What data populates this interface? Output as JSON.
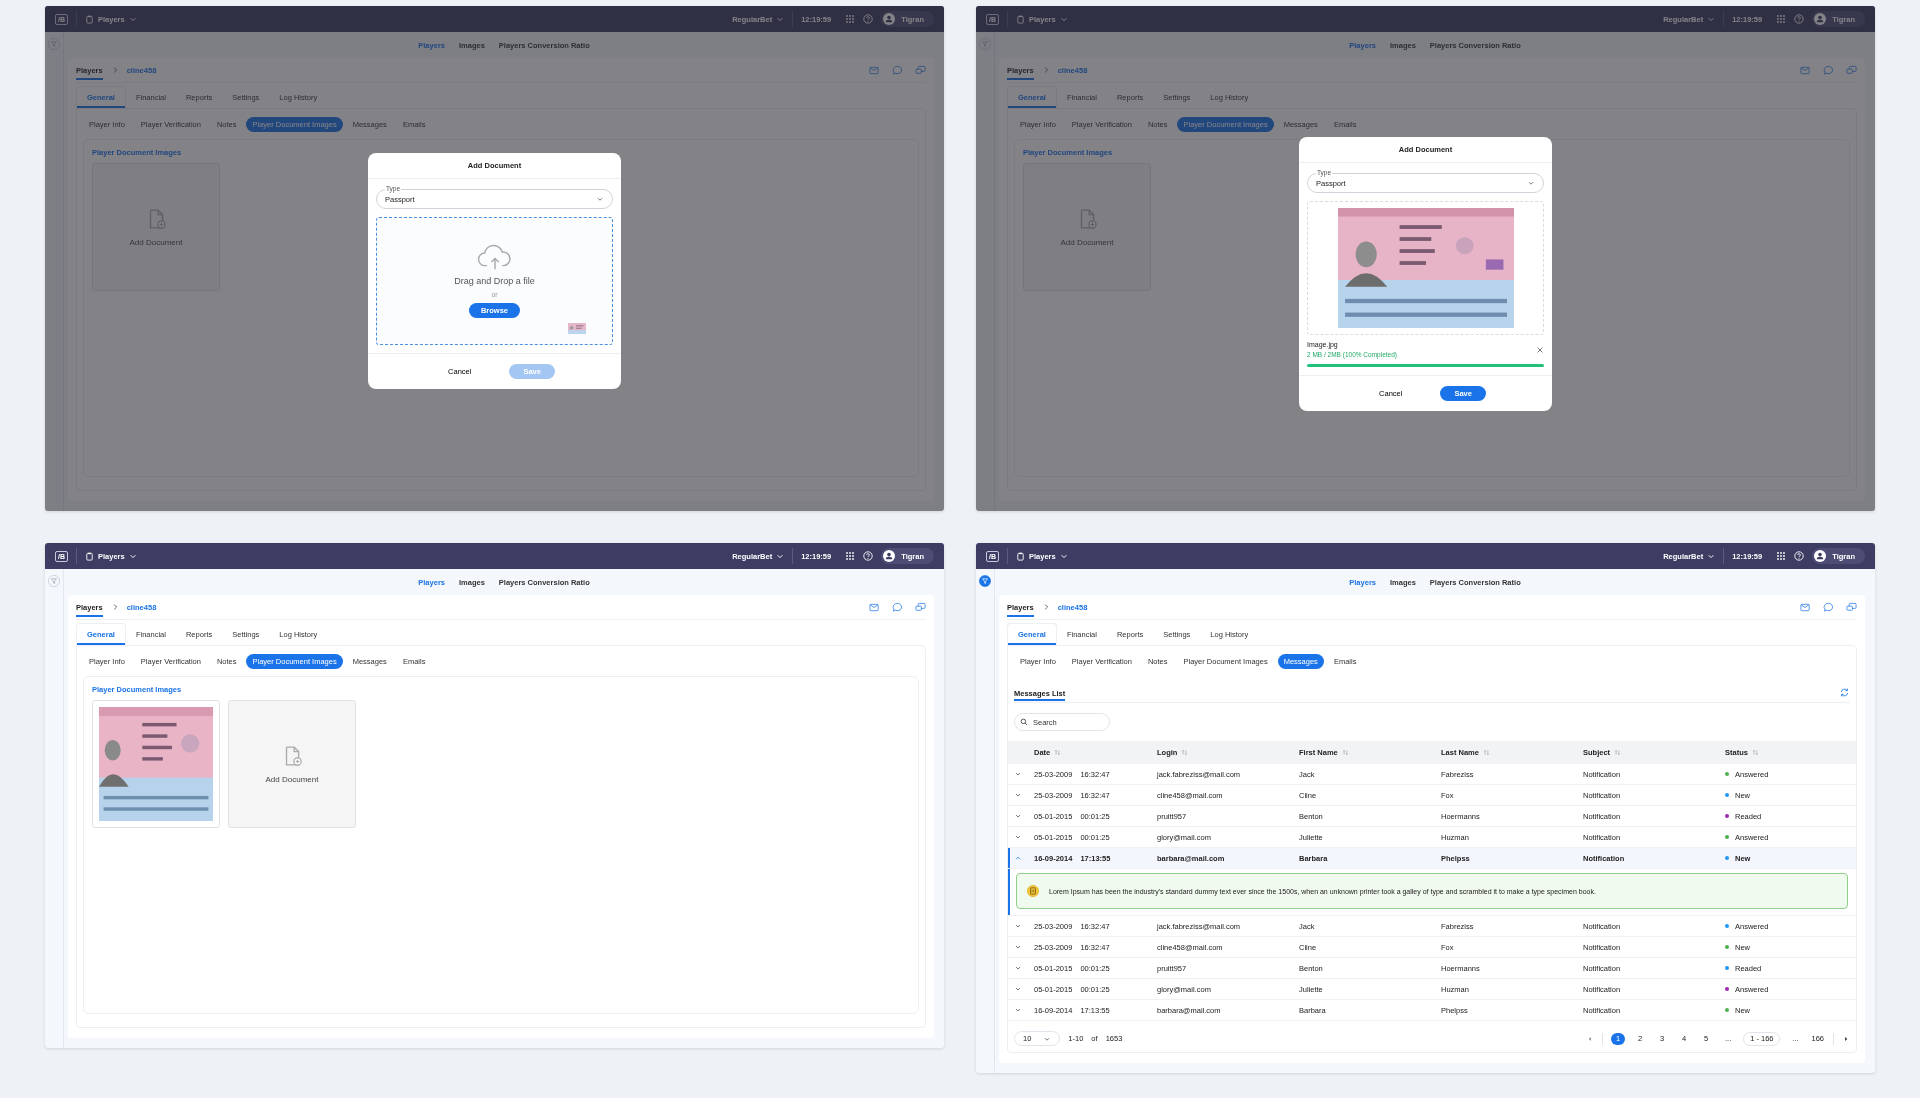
{
  "screens": [
    {
      "topbar": {
        "logo": "/B",
        "module": "Players",
        "brand": "RegularBet",
        "time": "12:19:59",
        "user": "Tigran"
      },
      "filter_active": false,
      "nav": [
        {
          "label": "Players",
          "selected": true
        },
        {
          "label": "Images",
          "selected": false
        },
        {
          "label": "Players Conversion Ratio",
          "selected": false
        }
      ],
      "breadcrumb": [
        "Players",
        "cline458"
      ],
      "tabs": [
        {
          "label": "General",
          "selected": true
        },
        {
          "label": "Financial",
          "selected": false
        },
        {
          "label": "Reports",
          "selected": false
        },
        {
          "label": "Settings",
          "selected": false
        },
        {
          "label": "Log History",
          "selected": false
        }
      ],
      "subtabs": [
        {
          "label": "Player Info",
          "selected": false
        },
        {
          "label": "Player Verification",
          "selected": false
        },
        {
          "label": "Notes",
          "selected": false
        },
        {
          "label": "Player Document Images",
          "selected": true
        },
        {
          "label": "Messages",
          "selected": false
        },
        {
          "label": "Emails",
          "selected": false
        }
      ],
      "content": {
        "kind": "documents",
        "title": "Player Document Images",
        "items": [
          {
            "kind": "add",
            "label": "Add Document"
          }
        ]
      },
      "modal": {
        "title": "Add Document",
        "field": {
          "label": "Type",
          "value": "Passport"
        },
        "body": {
          "kind": "dropzone",
          "text": "Drag and Drop a file",
          "or": "or",
          "button": "Browse"
        },
        "buttons": [
          {
            "label": "Cancel",
            "kind": "text",
            "disabled": false
          },
          {
            "label": "Save",
            "kind": "primary",
            "disabled": true
          }
        ]
      }
    },
    {
      "topbar": {
        "logo": "/B",
        "module": "Players",
        "brand": "RegularBet",
        "time": "12:19:59",
        "user": "Tigran"
      },
      "filter_active": false,
      "nav": [
        {
          "label": "Players",
          "selected": true
        },
        {
          "label": "Images",
          "selected": false
        },
        {
          "label": "Players Conversion Ratio",
          "selected": false
        }
      ],
      "breadcrumb": [
        "Players",
        "cline458"
      ],
      "tabs": [
        {
          "label": "General",
          "selected": true
        },
        {
          "label": "Financial",
          "selected": false
        },
        {
          "label": "Reports",
          "selected": false
        },
        {
          "label": "Settings",
          "selected": false
        },
        {
          "label": "Log History",
          "selected": false
        }
      ],
      "subtabs": [
        {
          "label": "Player Info",
          "selected": false
        },
        {
          "label": "Player Verification",
          "selected": false
        },
        {
          "label": "Notes",
          "selected": false
        },
        {
          "label": "Player Document Images",
          "selected": true
        },
        {
          "label": "Messages",
          "selected": false
        },
        {
          "label": "Emails",
          "selected": false
        }
      ],
      "content": {
        "kind": "documents",
        "title": "Player Document Images",
        "items": [
          {
            "kind": "add",
            "label": "Add Document"
          }
        ]
      },
      "modal": {
        "title": "Add Document",
        "field": {
          "label": "Type",
          "value": "Passport"
        },
        "body": {
          "kind": "preview",
          "file": "Image.jpg",
          "progress_text": "2 MB / 2MB (100% Completed)",
          "level": 1
        },
        "buttons": [
          {
            "label": "Cancel",
            "kind": "text",
            "disabled": false
          },
          {
            "label": "Save",
            "kind": "primary",
            "disabled": false
          }
        ]
      }
    },
    {
      "topbar": {
        "logo": "/B",
        "module": "Players",
        "brand": "RegularBet",
        "time": "12:19:59",
        "user": "Tigran"
      },
      "filter_active": false,
      "nav": [
        {
          "label": "Players",
          "selected": true
        },
        {
          "label": "Images",
          "selected": false
        },
        {
          "label": "Players Conversion Ratio",
          "selected": false
        }
      ],
      "breadcrumb": [
        "Players",
        "cline458"
      ],
      "tabs": [
        {
          "label": "General",
          "selected": true
        },
        {
          "label": "Financial",
          "selected": false
        },
        {
          "label": "Reports",
          "selected": false
        },
        {
          "label": "Settings",
          "selected": false
        },
        {
          "label": "Log History",
          "selected": false
        }
      ],
      "subtabs": [
        {
          "label": "Player Info",
          "selected": false
        },
        {
          "label": "Player Verification",
          "selected": false
        },
        {
          "label": "Notes",
          "selected": false
        },
        {
          "label": "Player Document Images",
          "selected": true
        },
        {
          "label": "Messages",
          "selected": false
        },
        {
          "label": "Emails",
          "selected": false
        }
      ],
      "content": {
        "kind": "documents",
        "title": "Player Document Images",
        "items": [
          {
            "kind": "picture"
          },
          {
            "kind": "add",
            "label": "Add Document"
          }
        ]
      }
    },
    {
      "topbar": {
        "logo": "/B",
        "module": "Players",
        "brand": "RegularBet",
        "time": "12:19:59",
        "user": "Tigran"
      },
      "filter_active": true,
      "nav": [
        {
          "label": "Players",
          "selected": true
        },
        {
          "label": "Images",
          "selected": false
        },
        {
          "label": "Players Conversion Ratio",
          "selected": false
        }
      ],
      "breadcrumb": [
        "Players",
        "cline458"
      ],
      "tabs": [
        {
          "label": "General",
          "selected": true
        },
        {
          "label": "Financial",
          "selected": false
        },
        {
          "label": "Reports",
          "selected": false
        },
        {
          "label": "Settings",
          "selected": false
        },
        {
          "label": "Log History",
          "selected": false
        }
      ],
      "subtabs": [
        {
          "label": "Player Info",
          "selected": false
        },
        {
          "label": "Player Verification",
          "selected": false
        },
        {
          "label": "Notes",
          "selected": false
        },
        {
          "label": "Player Document Images",
          "selected": false
        },
        {
          "label": "Messages",
          "selected": true
        },
        {
          "label": "Emails",
          "selected": false
        }
      ],
      "content": {
        "kind": "messages",
        "section_tabs": [
          {
            "label": "Messages List",
            "selected": true
          }
        ],
        "search": {
          "placeholder": "Search"
        },
        "columns": [
          "Date",
          "Login",
          "First Name",
          "Last Name",
          "Subject",
          "Status"
        ],
        "rows": [
          {
            "date": "25-03-2009",
            "time": "16:32:47",
            "login": "jack.fabreziss@mail.com",
            "first": "Jack",
            "last": "Fabreziss",
            "subject": "Notification",
            "status": "Answered",
            "color": "#4caf50",
            "expanded": false
          },
          {
            "date": "25-03-2009",
            "time": "16:32:47",
            "login": "cline458@mail.com",
            "first": "Cline",
            "last": "Fox",
            "subject": "Notification",
            "status": "New",
            "color": "#2196f3",
            "expanded": false
          },
          {
            "date": "05-01-2015",
            "time": "00:01:25",
            "login": "pruitt957",
            "first": "Benton",
            "last": "Hoermanns",
            "subject": "Notification",
            "status": "Readed",
            "color": "#9c27b0",
            "expanded": false
          },
          {
            "date": "05-01-2015",
            "time": "00:01:25",
            "login": "glory@mail.com",
            "first": "Juliette",
            "last": "Huzman",
            "subject": "Notification",
            "status": "Answered",
            "color": "#4caf50",
            "expanded": false
          },
          {
            "date": "16-09-2014",
            "time": "17:13:55",
            "login": "barbara@mail.com",
            "first": "Barbara",
            "last": "Phelpss",
            "subject": "Notification",
            "status": "New",
            "color": "#2196f3",
            "expanded": true,
            "message": "Lorem Ipsum has been the industry's standard dummy text ever since the 1500s, when an unknown printer took a galley of type and scrambled it to make a type specimen book."
          },
          {
            "date": "25-03-2009",
            "time": "16:32:47",
            "login": "jack.fabreziss@mail.com",
            "first": "Jack",
            "last": "Fabreziss",
            "subject": "Notification",
            "status": "Answered",
            "color": "#2196f3",
            "expanded": false
          },
          {
            "date": "25-03-2009",
            "time": "16:32:47",
            "login": "cline458@mail.com",
            "first": "Cline",
            "last": "Fox",
            "subject": "Notification",
            "status": "New",
            "color": "#4caf50",
            "expanded": false
          },
          {
            "date": "05-01-2015",
            "time": "00:01:25",
            "login": "pruitt957",
            "first": "Benton",
            "last": "Hoermanns",
            "subject": "Notification",
            "status": "Readed",
            "color": "#2196f3",
            "expanded": false
          },
          {
            "date": "05-01-2015",
            "time": "00:01:25",
            "login": "glory@mail.com",
            "first": "Juliette",
            "last": "Huzman",
            "subject": "Notification",
            "status": "Answered",
            "color": "#9c27b0",
            "expanded": false
          },
          {
            "date": "16-09-2014",
            "time": "17:13:55",
            "login": "barbara@mail.com",
            "first": "Barbara",
            "last": "Phelpss",
            "subject": "Notification",
            "status": "New",
            "color": "#4caf50",
            "expanded": false
          }
        ],
        "pagination": {
          "page_size": "10",
          "range": "1-10",
          "of": "of",
          "total": "1653",
          "pages": [
            {
              "label": "1",
              "selected": true
            },
            {
              "label": "2",
              "selected": false
            },
            {
              "label": "3",
              "selected": false
            },
            {
              "label": "4",
              "selected": false
            },
            {
              "label": "5",
              "selected": false
            },
            {
              "label": "...",
              "selected": false
            },
            {
              "label": "1 - 166",
              "selected": false
            },
            {
              "label": "...",
              "selected": false
            },
            {
              "label": "166",
              "selected": false
            }
          ]
        }
      }
    }
  ]
}
